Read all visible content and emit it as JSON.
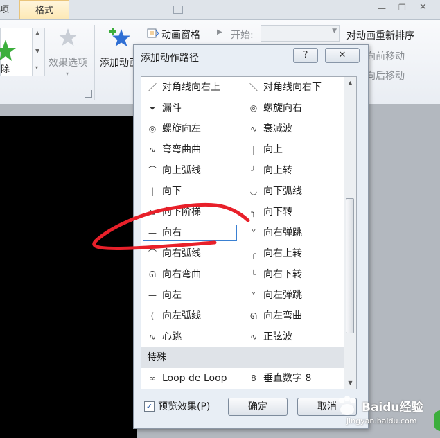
{
  "ribbon": {
    "tab_partial": "项",
    "tab_format": "格式",
    "left_partial_label": "除",
    "effect_options": "效果选项",
    "add_animation": "添加动画",
    "animation_pane": "动画窗格",
    "start_label": "开始:",
    "reorder_title": "对动画重新排序",
    "move_earlier": "向前移动",
    "move_later": "向后移动"
  },
  "dialog": {
    "title": "添加动作路径",
    "help_icon": "?",
    "close_icon": "✕",
    "left_items": [
      {
        "icon": "／",
        "label": "对角线向右上"
      },
      {
        "icon": "⏷",
        "label": "漏斗"
      },
      {
        "icon": "◎",
        "label": "螺旋向左"
      },
      {
        "icon": "∿",
        "label": "弯弯曲曲"
      },
      {
        "icon": "⌒",
        "label": "向上弧线"
      },
      {
        "icon": "|",
        "label": "向下"
      },
      {
        "icon": "↘",
        "label": "向下阶梯"
      },
      {
        "icon": "—",
        "label": "向右"
      },
      {
        "icon": "⌒",
        "label": "向右弧线"
      },
      {
        "icon": "ᘏ",
        "label": "向右弯曲"
      },
      {
        "icon": "—",
        "label": "向左"
      },
      {
        "icon": "(",
        "label": "向左弧线"
      },
      {
        "icon": "∿",
        "label": "心跳"
      }
    ],
    "right_items": [
      {
        "icon": "＼",
        "label": "对角线向右下"
      },
      {
        "icon": "◎",
        "label": "螺旋向右"
      },
      {
        "icon": "∿",
        "label": "衰减波"
      },
      {
        "icon": "|",
        "label": "向上"
      },
      {
        "icon": "╯",
        "label": "向上转"
      },
      {
        "icon": "◡",
        "label": "向下弧线"
      },
      {
        "icon": "╮",
        "label": "向下转"
      },
      {
        "icon": "ᘁ",
        "label": "向右弹跳"
      },
      {
        "icon": "╭",
        "label": "向右上转"
      },
      {
        "icon": "└",
        "label": "向右下转"
      },
      {
        "icon": "ᘁ",
        "label": "向左弹跳"
      },
      {
        "icon": "ᘏ",
        "label": "向左弯曲"
      },
      {
        "icon": "∿",
        "label": "正弦波"
      }
    ],
    "section_special": "特殊",
    "special_left": {
      "icon": "∞",
      "label": "Loop de Loop"
    },
    "special_right": {
      "icon": "8",
      "label": "垂直数字 8"
    },
    "preview_label": "预览效果(P)",
    "preview_checked": "✓",
    "ok_label": "确定",
    "cancel_label": "取消"
  },
  "watermark": {
    "brand": "Baidu经验",
    "url": "jingyan.baidu.com"
  },
  "colors": {
    "annotation": "#e8202a",
    "selection_border": "#3a80d2",
    "star_blue": "#2f6fd4",
    "star_green": "#3cae3c"
  }
}
